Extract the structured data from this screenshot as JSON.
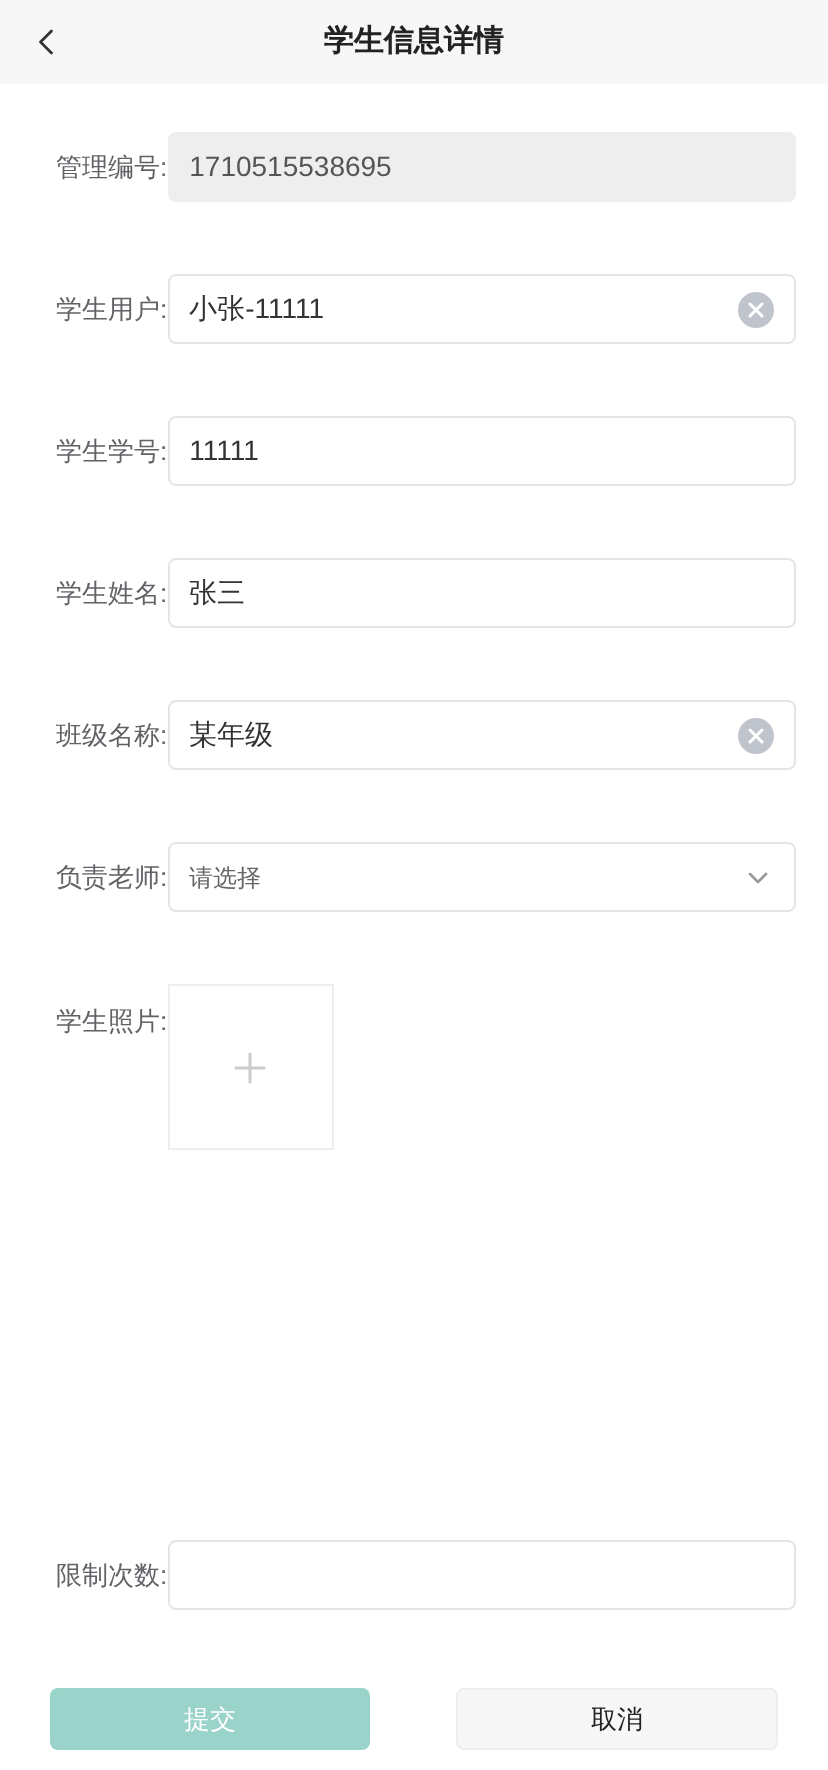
{
  "header": {
    "title": "学生信息详情"
  },
  "fields": [
    {
      "label": "管理编号:",
      "kind": "input",
      "value": "1710515538695",
      "disabled": true,
      "clearable": false
    },
    {
      "label": "学生用户:",
      "kind": "input",
      "value": "小张-11111",
      "disabled": false,
      "clearable": true
    },
    {
      "label": "学生学号:",
      "kind": "input",
      "value": "11111",
      "disabled": false,
      "clearable": false
    },
    {
      "label": "学生姓名:",
      "kind": "input",
      "value": "张三",
      "disabled": false,
      "clearable": false
    },
    {
      "label": "班级名称:",
      "kind": "input",
      "value": "某年级",
      "disabled": false,
      "clearable": true
    },
    {
      "label": "负责老师:",
      "kind": "select",
      "placeholder": "请选择"
    },
    {
      "label": "学生照片:",
      "kind": "upload"
    },
    {
      "label": "限制次数:",
      "kind": "input",
      "disabled": false
    }
  ],
  "buttons": [
    {
      "label": "提交",
      "kind": "primary",
      "disabled": true
    },
    {
      "label": "取消",
      "kind": "default",
      "disabled": false
    }
  ]
}
